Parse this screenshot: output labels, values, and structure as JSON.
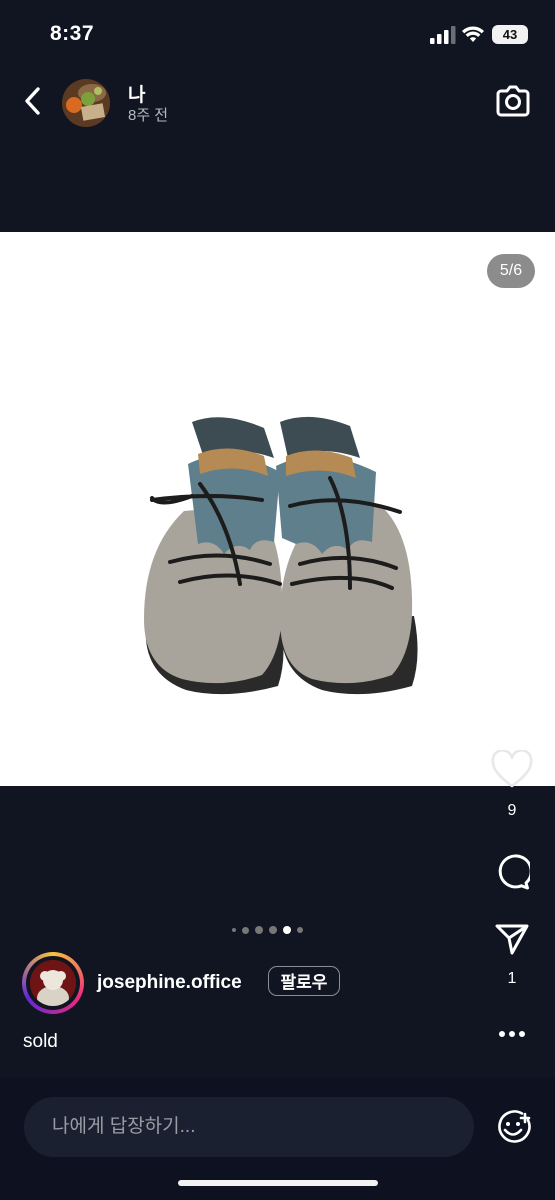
{
  "status_bar": {
    "time": "8:37",
    "battery": "43"
  },
  "story_header": {
    "name": "나",
    "time_ago": "8주 전"
  },
  "post": {
    "image_counter": "5/6",
    "total_images": 6,
    "current_image": 5,
    "like_count": "9",
    "share_count": "1"
  },
  "poster": {
    "username": "josephine.office",
    "follow_label": "팔로우"
  },
  "caption": "sold",
  "reply": {
    "placeholder": "나에게 답장하기..."
  },
  "colors": {
    "background": "#111521",
    "photo_bg": "#ffffff",
    "counter_bg": "#8c8c8c"
  },
  "icons": [
    "back-chevron-icon",
    "camera-icon",
    "heart-icon",
    "comment-icon",
    "share-icon",
    "more-icon",
    "sticker-icon"
  ]
}
